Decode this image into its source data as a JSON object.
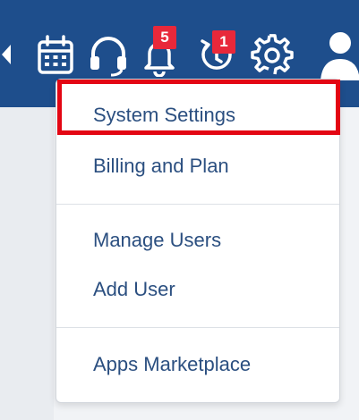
{
  "topbar": {
    "icons": [
      "back-arrow-icon",
      "calendar-icon",
      "headset-icon",
      "bell-icon",
      "refresh-icon",
      "gear-icon",
      "user-icon"
    ],
    "notifications_count": "5",
    "updates_count": "1"
  },
  "menu": {
    "items": [
      {
        "label": "System Settings"
      },
      {
        "label": "Billing and Plan"
      },
      {
        "label": "Manage Users"
      },
      {
        "label": "Add User"
      },
      {
        "label": "Apps Marketplace"
      }
    ]
  },
  "colors": {
    "topbar": "#1e4e8c",
    "menu_text": "#2b4f80",
    "badge": "#e8283a",
    "highlight": "#e30613"
  }
}
